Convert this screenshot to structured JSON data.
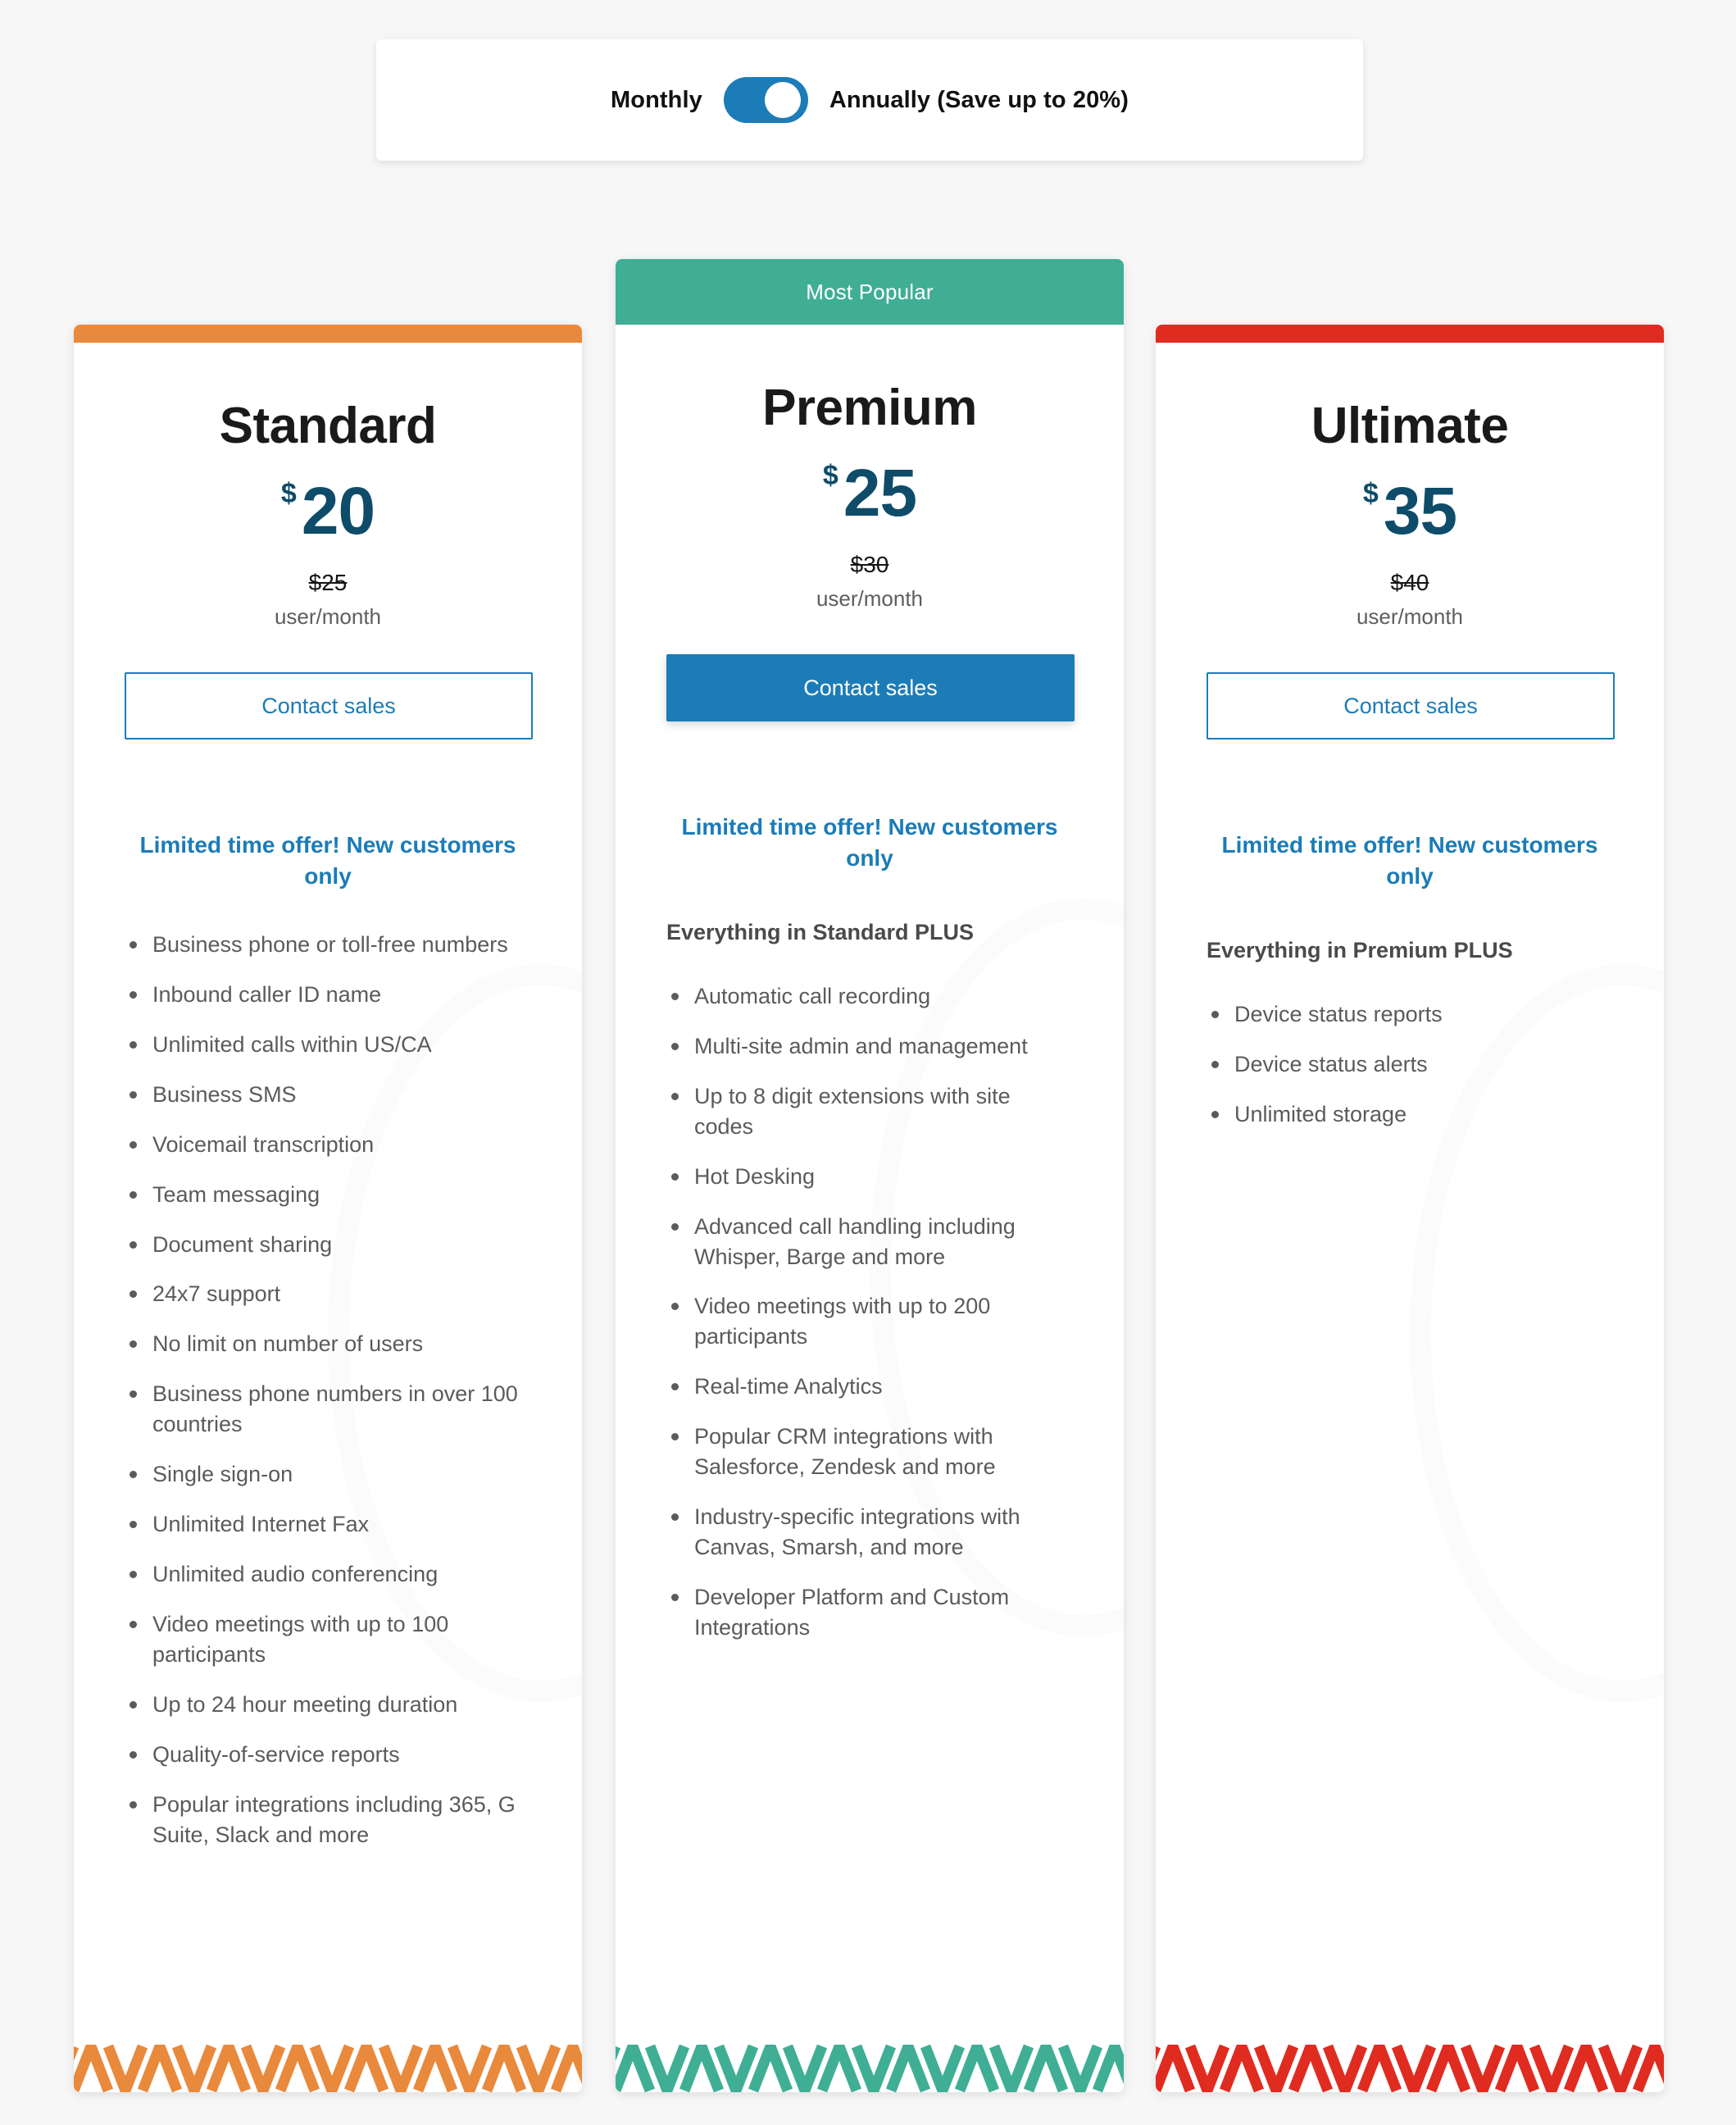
{
  "billing_toggle": {
    "monthly_label": "Monthly",
    "annually_label": "Annually (Save up to 20%)",
    "selected": "Annually",
    "switch_state": "on",
    "accent_color": "#1b7cb8"
  },
  "plans": [
    {
      "id": "standard",
      "name": "Standard",
      "badge": "",
      "accent_color": "#e8893c",
      "currency": "$",
      "price": "20",
      "old_price": "$25",
      "period": "user/month",
      "cta_label": "Contact sales",
      "cta_style": "outline",
      "offer": "Limited time offer! New customers only",
      "plus_heading": "",
      "features": [
        "Business phone or toll-free numbers",
        "Inbound caller ID name",
        "Unlimited calls within US/CA",
        "Business SMS",
        "Voicemail transcription",
        "Team messaging",
        "Document sharing",
        "24x7 support",
        "No limit on number of users",
        "Business phone numbers in over 100 countries",
        "Single sign-on",
        "Unlimited Internet Fax",
        "Unlimited audio conferencing",
        "Video meetings with up to 100 participants",
        "Up to 24 hour meeting duration",
        "Quality-of-service reports",
        "Popular integrations including 365, G Suite, Slack and more"
      ]
    },
    {
      "id": "premium",
      "name": "Premium",
      "badge": "Most Popular",
      "accent_color": "#3fae95",
      "currency": "$",
      "price": "25",
      "old_price": "$30",
      "period": "user/month",
      "cta_label": "Contact sales",
      "cta_style": "filled",
      "offer": "Limited time offer! New customers only",
      "plus_heading": "Everything in Standard PLUS",
      "features": [
        "Automatic call recording",
        "Multi-site admin and management",
        "Up to 8 digit extensions with site codes",
        "Hot Desking",
        "Advanced call handling including Whisper, Barge and more",
        "Video meetings with up to 200 participants",
        "Real-time Analytics",
        "Popular CRM integrations with Salesforce, Zendesk and more",
        "Industry-specific integrations with Canvas, Smarsh, and more",
        "Developer Platform and Custom Integrations"
      ]
    },
    {
      "id": "ultimate",
      "name": "Ultimate",
      "badge": "",
      "accent_color": "#e02b20",
      "currency": "$",
      "price": "35",
      "old_price": "$40",
      "period": "user/month",
      "cta_label": "Contact sales",
      "cta_style": "outline",
      "offer": "Limited time offer! New customers only",
      "plus_heading": "Everything in Premium PLUS",
      "features": [
        "Device status reports",
        "Device status alerts",
        "Unlimited storage"
      ]
    }
  ]
}
